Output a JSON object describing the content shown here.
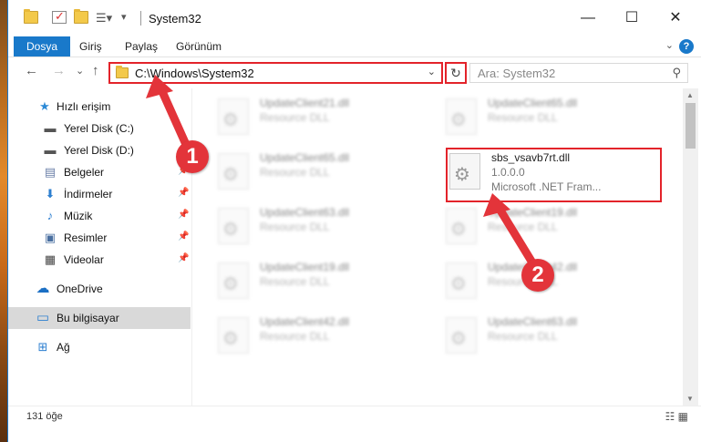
{
  "window": {
    "title": "System32",
    "minimize_glyph": "—",
    "maximize_glyph": "☐",
    "close_glyph": "✕"
  },
  "ribbon": {
    "tabs": [
      "Dosya",
      "Giriş",
      "Paylaş",
      "Görünüm"
    ],
    "help": "?"
  },
  "nav": {
    "back_glyph": "←",
    "forward_glyph": "→",
    "recent_glyph": "⌄",
    "up_glyph": "↑",
    "address": "C:\\Windows\\System32",
    "refresh_glyph": "↻",
    "search_placeholder": "Ara: System32"
  },
  "sidebar": {
    "items": [
      {
        "label": "Hızlı erişim",
        "icon": "star-icon",
        "glyph": "★",
        "color": "#2d8ad6"
      },
      {
        "label": "Yerel Disk (C:)",
        "icon": "drive-icon",
        "glyph": "▬",
        "color": "#555"
      },
      {
        "label": "Yerel Disk (D:)",
        "icon": "drive-icon",
        "glyph": "▬",
        "color": "#555"
      },
      {
        "label": "Belgeler",
        "icon": "documents-icon",
        "glyph": "▤",
        "color": "#6b7fa8"
      },
      {
        "label": "İndirmeler",
        "icon": "download-icon",
        "glyph": "⬇",
        "color": "#2d7fd0"
      },
      {
        "label": "Müzik",
        "icon": "music-icon",
        "glyph": "♪",
        "color": "#2d7fd0"
      },
      {
        "label": "Resimler",
        "icon": "pictures-icon",
        "glyph": "▣",
        "color": "#4a6fa0"
      },
      {
        "label": "Videolar",
        "icon": "videos-icon",
        "glyph": "▦",
        "color": "#444"
      },
      {
        "label": "OneDrive",
        "icon": "cloud-icon",
        "glyph": "☁",
        "color": "#1b6fc4"
      },
      {
        "label": "Bu bilgisayar",
        "icon": "computer-icon",
        "glyph": "▭",
        "color": "#2d7fd0"
      },
      {
        "label": "Ağ",
        "icon": "network-icon",
        "glyph": "⊞",
        "color": "#2d7fd0"
      }
    ]
  },
  "files": [
    {
      "name": "UpdateClient21.dll",
      "type": "Resource DLL"
    },
    {
      "name": "UpdateClient65.dll",
      "type": "Resource DLL"
    },
    {
      "name": "UpdateClient65.dll",
      "type": "Resource DLL"
    },
    {
      "name": "UpdateClient63.dll",
      "type": "Resource DLL"
    },
    {
      "name": "UpdateClient19.dll",
      "type": "Resource DLL"
    },
    {
      "name": "UpdateClient63.dll",
      "type": "Resource DLL"
    },
    {
      "name": "UpdateClient19.dll",
      "type": "Resource DLL"
    },
    {
      "name": "UpdateClient42.dll",
      "type": "Resource DLL"
    },
    {
      "name": "UpdateClient42.dll",
      "type": "Resource DLL"
    },
    {
      "name": "UpdateClient63.dll",
      "type": "Resource DLL"
    }
  ],
  "highlighted_file": {
    "name": "sbs_vsavb7rt.dll",
    "version": "1.0.0.0",
    "company": "Microsoft .NET Fram..."
  },
  "status": {
    "count": "131 öğe",
    "view_glyphs": "☷ ▦"
  },
  "annotations": {
    "step1": "1",
    "step2": "2",
    "color": "#e3343a"
  }
}
